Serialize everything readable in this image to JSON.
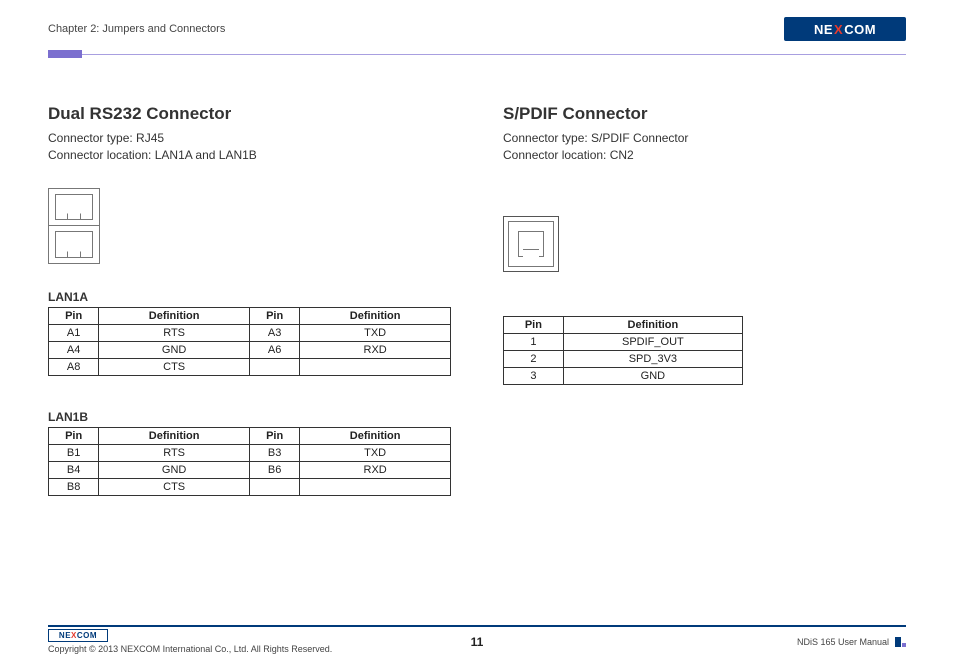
{
  "header": {
    "chapter": "Chapter 2: Jumpers and Connectors",
    "brand_pre": "NE",
    "brand_x": "X",
    "brand_post": "COM"
  },
  "left": {
    "title": "Dual RS232 Connector",
    "type_label": "Connector type: RJ45",
    "loc_label": "Connector location: LAN1A and LAN1B",
    "table1_title": "LAN1A",
    "table2_title": "LAN1B",
    "th_pin": "Pin",
    "th_def": "Definition",
    "t1": {
      "r1c1": "A1",
      "r1c2": "RTS",
      "r1c3": "A3",
      "r1c4": "TXD",
      "r2c1": "A4",
      "r2c2": "GND",
      "r2c3": "A6",
      "r2c4": "RXD",
      "r3c1": "A8",
      "r3c2": "CTS",
      "r3c3": "",
      "r3c4": ""
    },
    "t2": {
      "r1c1": "B1",
      "r1c2": "RTS",
      "r1c3": "B3",
      "r1c4": "TXD",
      "r2c1": "B4",
      "r2c2": "GND",
      "r2c3": "B6",
      "r2c4": "RXD",
      "r3c1": "B8",
      "r3c2": "CTS",
      "r3c3": "",
      "r3c4": ""
    }
  },
  "right": {
    "title": "S/PDIF Connector",
    "type_label": "Connector type: S/PDIF Connector",
    "loc_label": "Connector location: CN2",
    "th_pin": "Pin",
    "th_def": "Definition",
    "t": {
      "r1c1": "1",
      "r1c2": "SPDIF_OUT",
      "r2c1": "2",
      "r2c2": "SPD_3V3",
      "r3c1": "3",
      "r3c2": "GND"
    }
  },
  "footer": {
    "copyright": "Copyright © 2013 NEXCOM International Co., Ltd. All Rights Reserved.",
    "page": "11",
    "manual": "NDiS 165 User Manual",
    "brand_pre": "NE",
    "brand_x": "X",
    "brand_post": "COM"
  }
}
